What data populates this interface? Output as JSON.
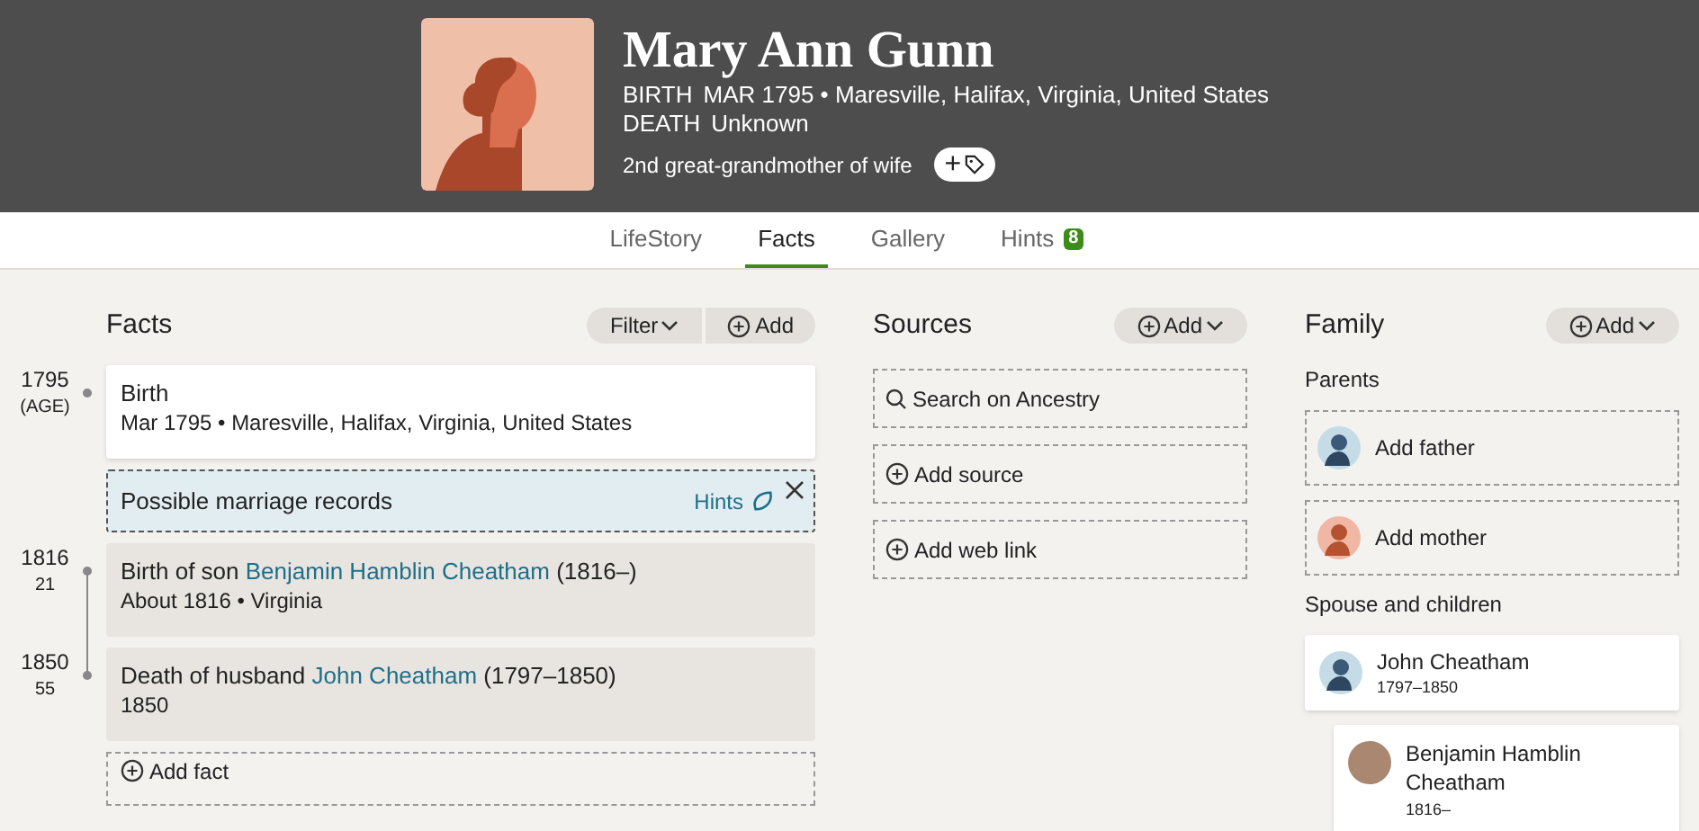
{
  "header": {
    "name": "Mary Ann Gunn",
    "birth_label": "BIRTH",
    "birth": "MAR 1795 • Maresville, Halifax, Virginia, United States",
    "death_label": "DEATH",
    "death": "Unknown",
    "relation": "2nd great-grandmother of wife",
    "tag_button": "+"
  },
  "tabs": [
    {
      "label": "LifeStory",
      "selected": false
    },
    {
      "label": "Facts",
      "selected": true
    },
    {
      "label": "Gallery",
      "selected": false
    },
    {
      "label": "Hints",
      "selected": false,
      "badge": "8"
    }
  ],
  "facts": {
    "title": "Facts",
    "filter_button": "Filter",
    "add_button": "Add",
    "items": [
      {
        "kind": "fact",
        "year": "1795",
        "age": "(AGE)",
        "title": "Birth",
        "detail": "Mar 1795 • Maresville, Halifax, Virginia, United States"
      },
      {
        "kind": "hint",
        "title": "Possible marriage records",
        "link": "Hints"
      },
      {
        "kind": "event",
        "year": "1816",
        "age": "21",
        "title_before": "Birth of son ",
        "person": "Benjamin Hamblin Cheatham",
        "title_after": " (1816–)",
        "detail": "About 1816 • Virginia"
      },
      {
        "kind": "event",
        "year": "1850",
        "age": "55",
        "title_before": "Death of husband ",
        "person": "John Cheatham",
        "title_after": " (1797–1850)",
        "detail": "1850"
      }
    ],
    "add_fact": "Add fact"
  },
  "sources": {
    "title": "Sources",
    "add_button": "Add",
    "items": [
      {
        "kind": "search",
        "label": "Search on Ancestry"
      },
      {
        "kind": "add",
        "label": "Add source"
      },
      {
        "kind": "add",
        "label": "Add web link"
      }
    ]
  },
  "family": {
    "title": "Family",
    "add_button": "Add",
    "parents_label": "Parents",
    "parents": [
      {
        "kind": "male",
        "label": "Add father"
      },
      {
        "kind": "female",
        "label": "Add mother"
      }
    ],
    "spouse_label": "Spouse and children",
    "spouses": [
      {
        "name": "John Cheatham",
        "dates": "1797–1850",
        "kind": "male",
        "children": [
          {
            "name": "Benjamin Hamblin Cheatham",
            "dates": "1816–",
            "kind": "photo"
          }
        ]
      }
    ]
  }
}
